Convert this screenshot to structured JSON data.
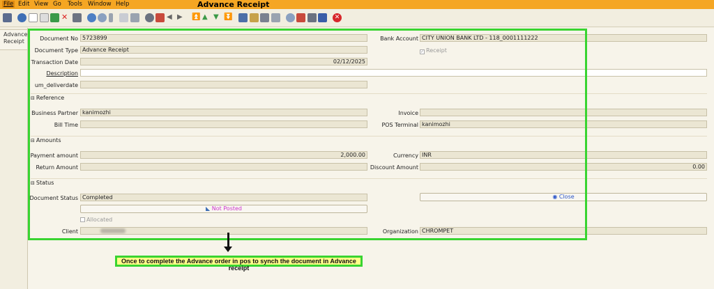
{
  "menu": {
    "file": "File",
    "edit": "Edit",
    "view": "View",
    "go": "Go",
    "tools": "Tools",
    "window": "Window",
    "help": "Help"
  },
  "app_title": "Advance Receipt",
  "side_tab": {
    "line1": "Advance",
    "line2": "Receipt"
  },
  "form": {
    "document_no": {
      "label": "Document No",
      "value": "5723899"
    },
    "document_type": {
      "label": "Document Type",
      "value": "Advance Receipt"
    },
    "transaction_date": {
      "label": "Transaction Date",
      "value": "02/12/2025"
    },
    "description": {
      "label": "Description",
      "value": ""
    },
    "um_deliverdate": {
      "label": "um_deliverdate",
      "value": ""
    },
    "bank_account": {
      "label": "Bank Account",
      "value": "CITY UNION BANK LTD - 118_0001111222"
    },
    "receipt": {
      "label": "Receipt"
    }
  },
  "reference": {
    "title": "Reference",
    "business_partner": {
      "label": "Business Partner",
      "value": "kanimozhi"
    },
    "bill_time": {
      "label": "Bill Time",
      "value": ""
    },
    "invoice": {
      "label": "Invoice",
      "value": ""
    },
    "pos_terminal": {
      "label": "POS Terminal",
      "value": "kanimozhi"
    }
  },
  "amounts": {
    "title": "Amounts",
    "payment_amount": {
      "label": "Payment amount",
      "value": "2,000.00"
    },
    "return_amount": {
      "label": "Return Amount",
      "value": ""
    },
    "currency": {
      "label": "Currency",
      "value": "INR"
    },
    "discount_amount": {
      "label": "Discount Amount",
      "value": "0.00"
    }
  },
  "status": {
    "title": "Status",
    "document_status": {
      "label": "Document Status",
      "value": "Completed"
    },
    "posted_button": "Not Posted",
    "close_button": "Close",
    "allocated": {
      "label": "Allocated"
    },
    "client": {
      "label": "Client",
      "value": ""
    },
    "organization": {
      "label": "Organization",
      "value": "CHROMPET"
    }
  },
  "annotation": "Once to complete the Advance order in pos to synch the document in Advance receipt",
  "colors": {
    "menubar": "#f5a623",
    "highlight": "#39d431",
    "callout_bg": "#ffff88",
    "not_posted_text": "#cc33cc",
    "close_text": "#2b55c9"
  }
}
